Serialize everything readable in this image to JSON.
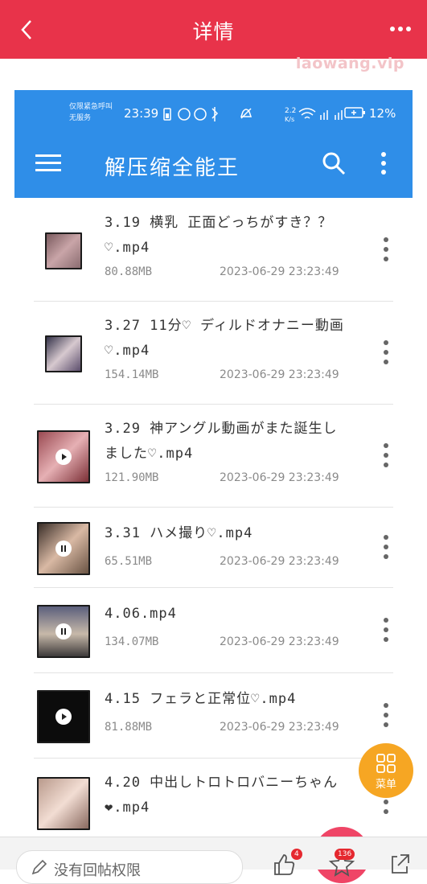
{
  "topbar": {
    "title": "详情"
  },
  "watermark": "laowang.vip",
  "phone": {
    "status_bar": {
      "carrier": "仅限紧急呼叫\n无服务",
      "time": "23:39",
      "speed": "2.2\nK/s",
      "battery": "12%"
    },
    "app_title": "解压缩全能王"
  },
  "files": [
    {
      "name": "3.19 横乳 正面どっちがすき？？ ♡.mp4",
      "size": "80.88MB",
      "date": "2023-06-29 23:23:49",
      "thumb": "plain"
    },
    {
      "name": "3.27 11分♡ ディルドオナニー動画♡.mp4",
      "size": "154.14MB",
      "date": "2023-06-29 23:23:49",
      "thumb": "plain"
    },
    {
      "name": "3.29 神アングル動画がまた誕生しました♡.mp4",
      "size": "121.90MB",
      "date": "2023-06-29 23:23:49",
      "thumb": "play"
    },
    {
      "name": "3.31 ハメ撮り♡.mp4",
      "size": "65.51MB",
      "date": "2023-06-29 23:23:49",
      "thumb": "pause"
    },
    {
      "name": "4.06.mp4",
      "size": "134.07MB",
      "date": "2023-06-29 23:23:49",
      "thumb": "pause"
    },
    {
      "name": "4.15 フェラと正常位♡.mp4",
      "size": "81.88MB",
      "date": "2023-06-29 23:23:49",
      "thumb": "play"
    },
    {
      "name": "4.20 中出しトロトロバニーちゃん❤.mp4",
      "size": "",
      "date": "",
      "thumb": "plain"
    }
  ],
  "fab": {
    "label": "菜单"
  },
  "bottombar": {
    "reply_placeholder": "没有回帖权限",
    "like_count": "4",
    "favorite_count": "136"
  },
  "colors": {
    "topbar": "#e8334a",
    "app_header": "#2f8ee8",
    "fab": "#f6a623"
  }
}
